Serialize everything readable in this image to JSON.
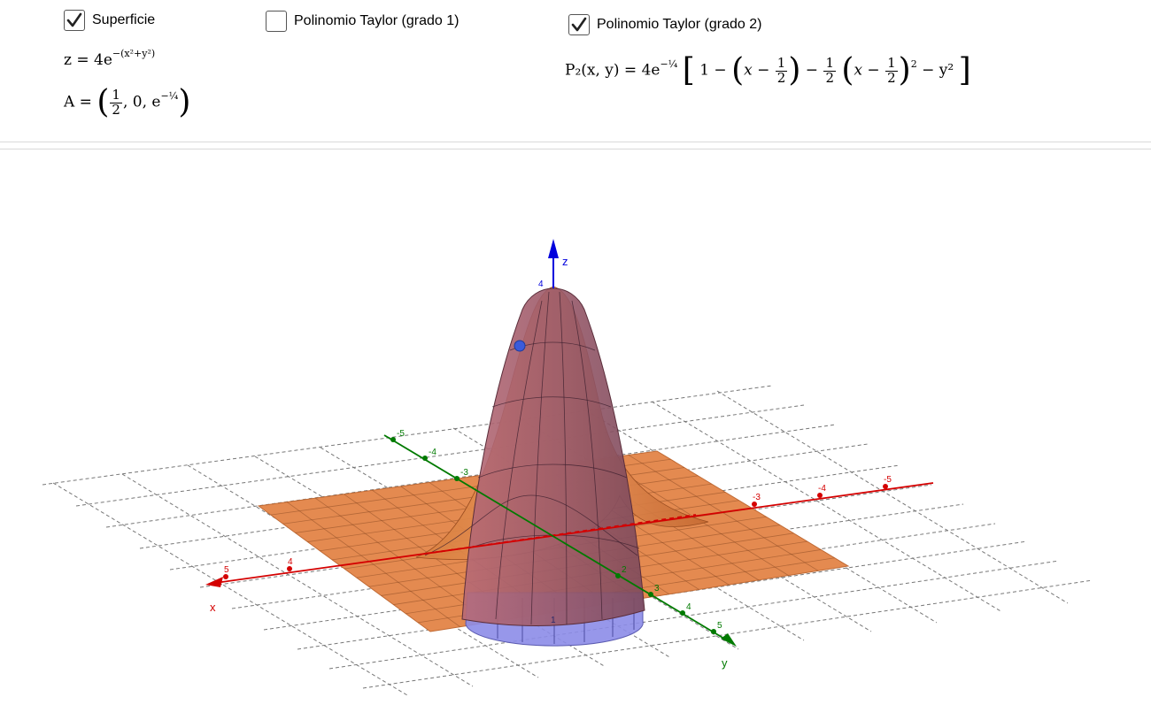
{
  "controls": {
    "superficie": {
      "label": "Superficie",
      "checked": true
    },
    "taylor1": {
      "label": "Polinomio Taylor (grado 1)",
      "checked": false
    },
    "taylor2": {
      "label": "Polinomio Taylor (grado 2)",
      "checked": true
    }
  },
  "formulas": {
    "surface": {
      "lhs": "z = 4e",
      "exp": "−(x²+y²)"
    },
    "point": {
      "lhs": "A =",
      "x_num": "1",
      "x_den": "2",
      "y": "0",
      "z_base": "e",
      "z_exp": "−¼"
    },
    "taylor2": {
      "lhs": "P₂(x, y) = 4e",
      "coef_exp": "−¼",
      "one": "1 −",
      "x_var": "x −",
      "half_num": "1",
      "half_den": "2",
      "minus": "−",
      "sq": "2",
      "tail": "− y²"
    }
  },
  "axes": {
    "x_label": "x",
    "y_label": "y",
    "z_label": "z",
    "x_ticks": [
      "5",
      "4",
      "-3",
      "-4",
      "-5"
    ],
    "y_ticks": [
      "-5",
      "-4",
      "-3",
      "2",
      "3",
      "4",
      "5"
    ],
    "z_ticks": [
      "4",
      "1"
    ]
  },
  "colors": {
    "surface": "#e98a4e",
    "surface_edge": "#b9612c",
    "taylor": "#a45e70",
    "taylor_base": "#8f8fe8",
    "x_axis": "#d40000",
    "y_axis": "#007a00",
    "z_axis": "#0000dd",
    "point": "#3b5bdb"
  },
  "point_A": {
    "label": "A"
  }
}
